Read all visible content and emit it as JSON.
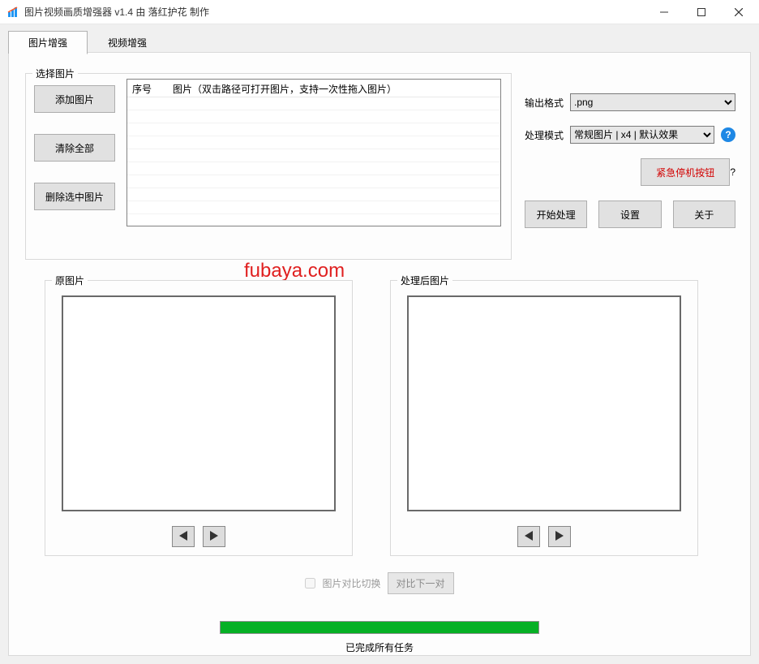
{
  "titlebar": {
    "title": "图片视频画质增强器 v1.4     由 落红护花 制作"
  },
  "tabs": {
    "image": "图片增强",
    "video": "视频增强"
  },
  "group_select": {
    "legend": "选择图片",
    "add": "添加图片",
    "clear": "清除全部",
    "delete": "删除选中图片",
    "col_index": "序号",
    "col_path": "图片（双击路径可打开图片，支持一次性拖入图片）"
  },
  "options": {
    "output_label": "输出格式",
    "output_value": ".png",
    "mode_label": "处理模式",
    "mode_value": "常规图片 | x4 | 默认效果",
    "help": "?",
    "stop": "紧急停机按钮",
    "start": "开始处理",
    "settings": "设置",
    "about": "关于"
  },
  "watermark": "fubaya.com",
  "preview": {
    "original": "原图片",
    "processed": "处理后图片"
  },
  "compare": {
    "checkbox_label": "图片对比切换",
    "next": "对比下一对"
  },
  "status": "已完成所有任务"
}
